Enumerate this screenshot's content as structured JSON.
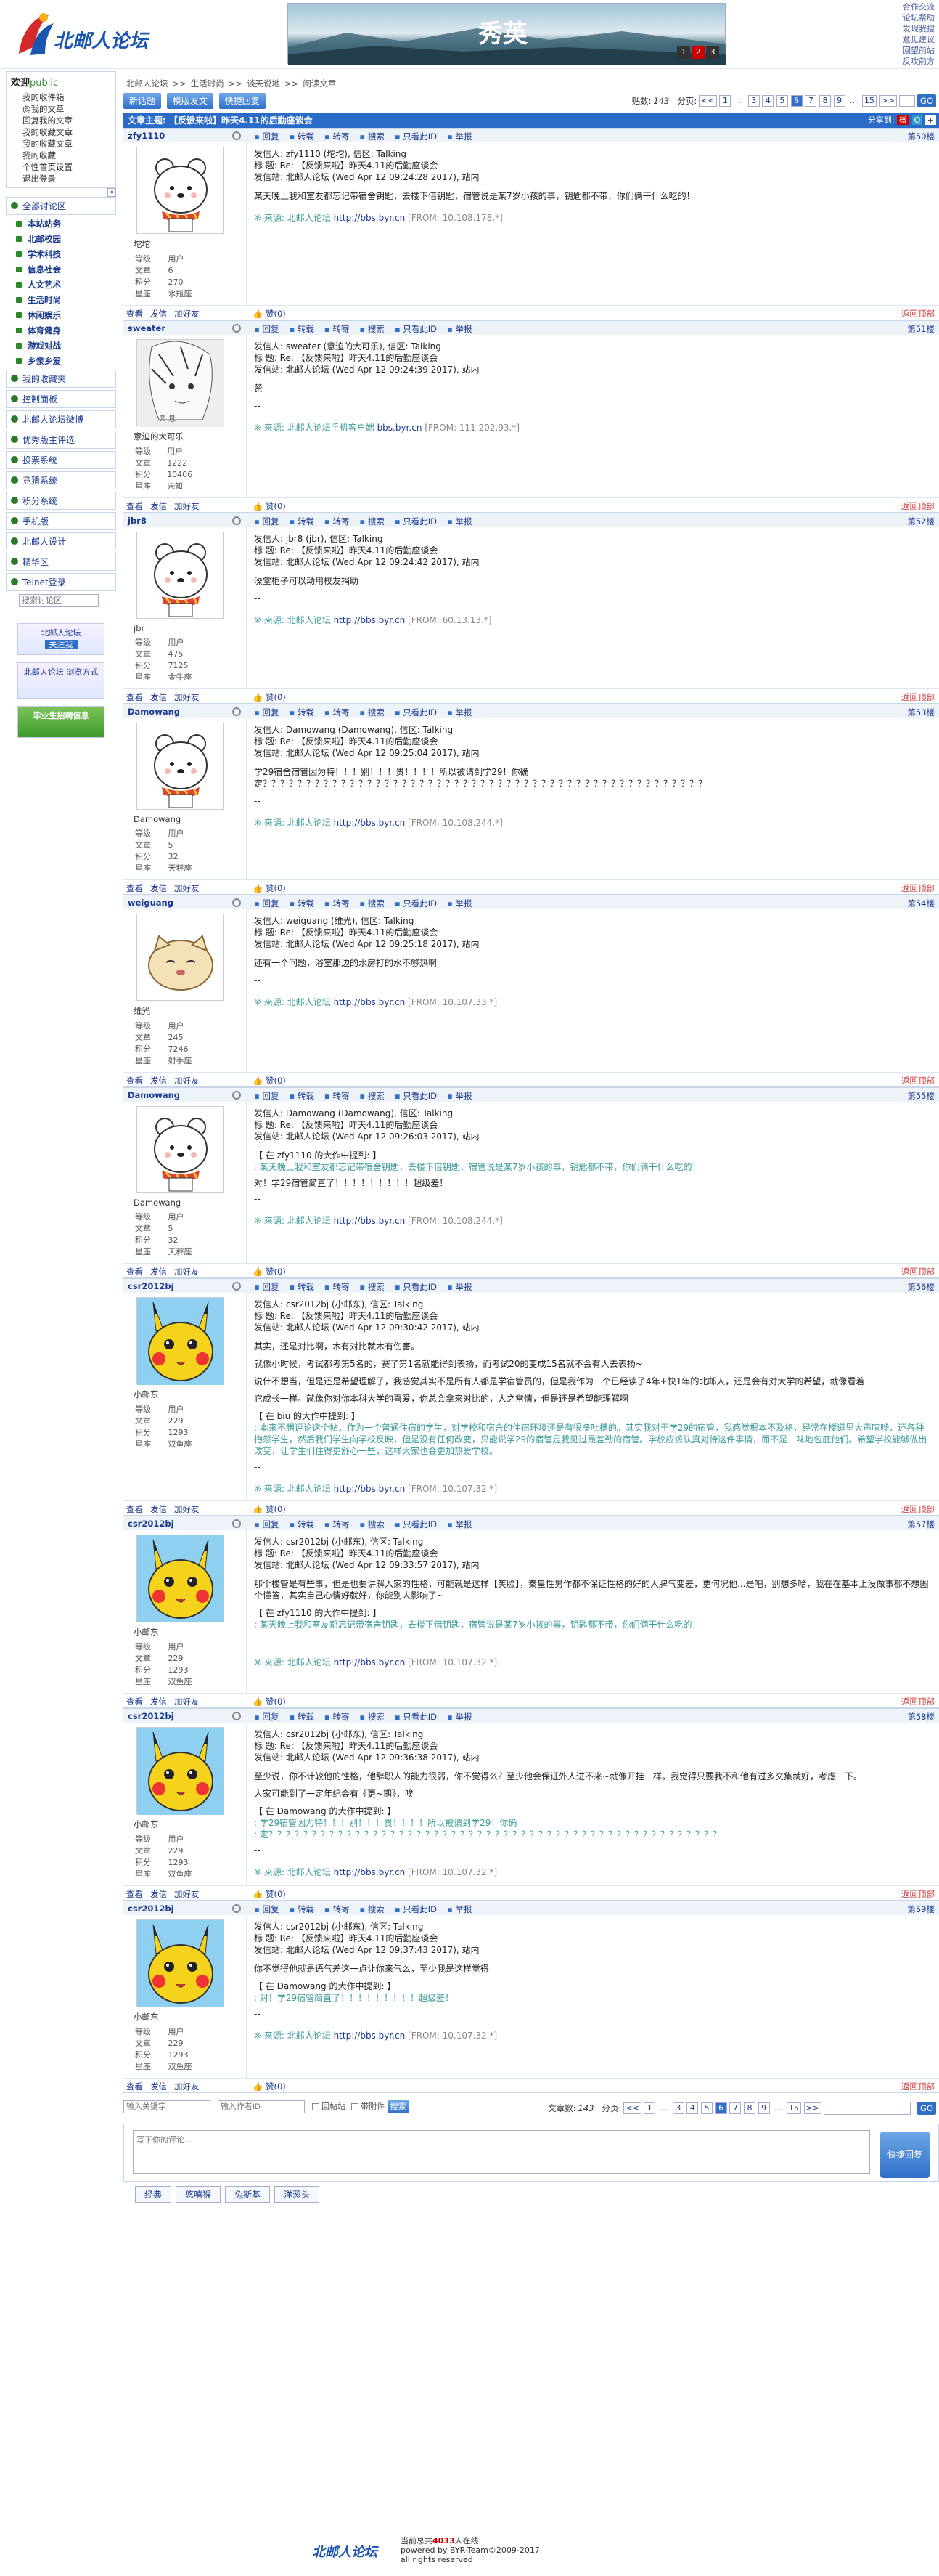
{
  "logo_text": "北邮人论坛",
  "banner": {
    "title": "秀英",
    "dots": [
      "1",
      "2",
      "3"
    ]
  },
  "toplinks": [
    "合作交流",
    "论坛帮助",
    "发现我搜",
    "意见建议",
    "回望前站",
    "反攻前方"
  ],
  "left": {
    "welcome": {
      "title": "欢迎",
      "user": "public",
      "items": [
        "我的收件箱",
        "@我的文章",
        "回复我的文章",
        "我的收藏文章",
        "我的收藏文章",
        "我的收藏",
        "个性首页设置",
        "退出登录"
      ]
    },
    "nav": [
      "全部讨论区",
      "本站站务",
      "北邮校园",
      "学术科技",
      "信息社会",
      "人文艺术",
      "生活时尚",
      "休闲娱乐",
      "体育健身",
      "游戏对战",
      "乡亲乡爱",
      "我的收藏夹",
      "控制面板",
      "北邮人论坛微博",
      "优秀版主评选",
      "投票系统",
      "竞猜系统",
      "积分系统",
      "手机版",
      "北邮人设计",
      "精华区",
      "Telnet登录"
    ],
    "search_ph": "搜索讨论区",
    "promo1": "北邮人论坛",
    "promo1b": "关注我",
    "promo2": "北邮人论坛 浏览方式",
    "promo3": "毕业生招聘信息"
  },
  "crumbs": [
    "北邮人论坛",
    ">>",
    "生活时尚",
    ">>",
    "谈天说地",
    ">>",
    "阅读文章"
  ],
  "toolbar": {
    "new": "新话题",
    "mod": "模版发文",
    "quick": "快捷回复",
    "count_label": "贴数:",
    "count": "143",
    "page_label": "分页:",
    "pages": [
      "<<",
      "1",
      "...",
      "3",
      "4",
      "5",
      "6",
      "7",
      "8",
      "9",
      "...",
      "15",
      ">>"
    ],
    "go": "GO"
  },
  "subject": {
    "label": "文章主题: 【反馈来啦】昨天4.11的后勤座谈会",
    "share": "分享到:"
  },
  "actions": [
    "回复",
    "转载",
    "转寄",
    "搜索",
    "只看此ID",
    "举报"
  ],
  "footer_actions": [
    "查看",
    "发信",
    "加好友"
  ],
  "praise": "赞(0)",
  "back_top": "返回顶部",
  "stat_labels": [
    "等级",
    "文章",
    "积分",
    "星座"
  ],
  "posts": [
    {
      "uid": "zfy1110",
      "floor": "第50楼",
      "name": "坨坨",
      "stats": [
        "用户",
        "6",
        "270",
        "水瓶座"
      ],
      "meta": [
        "发信人: zfy1110 (坨坨), 信区: Talking",
        "标  题: Re: 【反馈来啦】昨天4.11的后勤座谈会",
        "发信站: 北邮人论坛 (Wed Apr 12 09:24:28 2017), 站内"
      ],
      "text": [
        "某天晚上我和室友都忘记带宿舍钥匙，去楼下借钥匙，宿管说是某7岁小孩的事，钥匙都不带，你们俩干什么吃的！"
      ],
      "quote": [],
      "after": [],
      "src": "※ 来源: 北邮人论坛",
      "srcurl": "http://bbs.byr.cn",
      "ip": "[FROM: 10.108.178.*]"
    },
    {
      "uid": "sweater",
      "floor": "第51楼",
      "name": "意迫的大可乐",
      "stats": [
        "用户",
        "1222",
        "10406",
        "未知"
      ],
      "meta": [
        "发信人: sweater (意迫的大可乐), 信区: Talking",
        "标  题: Re: 【反馈来啦】昨天4.11的后勤座谈会",
        "发信站: 北邮人论坛 (Wed Apr 12 09:24:39 2017), 站内"
      ],
      "text": [
        "赞",
        "--"
      ],
      "quote": [],
      "after": [],
      "src": "※ 来源: 北邮人论坛手机客户端",
      "srcurl": "bbs.byr.cn",
      "ip": "[FROM: 111.202.93.*]"
    },
    {
      "uid": "jbr8",
      "floor": "第52楼",
      "name": "jbr",
      "stats": [
        "用户",
        "475",
        "7125",
        "金牛座"
      ],
      "meta": [
        "发信人: jbr8 (jbr), 信区: Talking",
        "标  题: Re: 【反馈来啦】昨天4.11的后勤座谈会",
        "发信站: 北邮人论坛 (Wed Apr 12 09:24:42 2017), 站内"
      ],
      "text": [
        "澡堂柜子可以动用校友捐助",
        "--"
      ],
      "quote": [],
      "after": [],
      "src": "※ 来源: 北邮人论坛",
      "srcurl": "http://bbs.byr.cn",
      "ip": "[FROM: 60.13.13.*]"
    },
    {
      "uid": "Damowang",
      "floor": "第53楼",
      "name": "Damowang",
      "stats": [
        "用户",
        "5",
        "32",
        "天秤座"
      ],
      "meta": [
        "发信人: Damowang (Damowang), 信区: Talking",
        "标  题: Re: 【反馈来啦】昨天4.11的后勤座谈会",
        "发信站: 北邮人论坛 (Wed Apr 12 09:25:04 2017), 站内"
      ],
      "text": [
        "学29宿舍宿管因为特！！！别！！！贵！！！！所以被请到学29！你确定？？？？？？？？？？？？？？？？？？？？？？？？？？？？？？？？？？？？？？？？？？？？？？？？？？？",
        "--"
      ],
      "quote": [],
      "after": [],
      "src": "※ 来源: 北邮人论坛",
      "srcurl": "http://bbs.byr.cn",
      "ip": "[FROM: 10.108.244.*]"
    },
    {
      "uid": "weiguang",
      "floor": "第54楼",
      "name": "维光",
      "stats": [
        "用户",
        "245",
        "7246",
        "射手座"
      ],
      "meta": [
        "发信人: weiguang (维光), 信区: Talking",
        "标  题: Re: 【反馈来啦】昨天4.11的后勤座谈会",
        "发信站: 北邮人论坛 (Wed Apr 12 09:25:18 2017), 站内"
      ],
      "text": [
        "还有一个问题，浴室那边的水房打的水不够热啊",
        "--"
      ],
      "quote": [],
      "after": [],
      "src": "※ 来源: 北邮人论坛",
      "srcurl": "http://bbs.byr.cn",
      "ip": "[FROM: 10.107.33.*]"
    },
    {
      "uid": "Damowang",
      "floor": "第55楼",
      "name": "Damowang",
      "stats": [
        "用户",
        "5",
        "32",
        "天秤座"
      ],
      "meta": [
        "发信人: Damowang (Damowang), 信区: Talking",
        "标  题: Re: 【反馈来啦】昨天4.11的后勤座谈会",
        "发信站: 北邮人论坛 (Wed Apr 12 09:26:03 2017), 站内"
      ],
      "text": [
        "【 在 zfy1110 的大作中提到: 】"
      ],
      "quote": [
        ": 某天晚上我和室友都忘记带宿舍钥匙，去楼下借钥匙，宿管说是某7岁小孩的事，钥匙都不带，你们俩干什么吃的！"
      ],
      "after": [
        "对！学29宿管简直了！！！！！！！！！超级差！",
        "--"
      ],
      "src": "※ 来源: 北邮人论坛",
      "srcurl": "http://bbs.byr.cn",
      "ip": "[FROM: 10.108.244.*]"
    },
    {
      "uid": "csr2012bj",
      "floor": "第56楼",
      "name": "小邮东",
      "stats": [
        "用户",
        "229",
        "1293",
        "双鱼座"
      ],
      "meta": [
        "发信人: csr2012bj (小邮东), 信区: Talking",
        "标  题: Re: 【反馈来啦】昨天4.11的后勤座谈会",
        "发信站: 北邮人论坛 (Wed Apr 12 09:30:42 2017), 站内"
      ],
      "text": [
        "其实，还是对比啊，木有对比就木有伤害。",
        "就像小时候，考试都考第5名的，赛了第1名就能得到表扬，而考试20的变成15名就不会有人去表扬~",
        "说什不想当，但是还是希望理解了，我感觉其实不是所有人都是学宿管员的，但是我作为一个已经读了4年+快1年的北邮人，还是会有对大学的希望，就像看着",
        "它成长一样。就像你对你本科大学的喜爱，你总会拿来对比的，人之常情，但是还是希望能理解啊",
        "【 在 biu 的大作中提到: 】"
      ],
      "quote": [
        ": 本来不想评论这个帖，作为一个普通住宿的学生，对学校和宿舍的住宿环境还是有很多吐槽的。其实我对于学29的宿管，我感觉根本不及格，经常在楼道里大声喧哗，还各种抱怨学生，然后我们学生向学校反映，但是没有任何改变，只能说学29的宿管是我见过最差劲的宿管。学校应该认真对待这件事情，而不是一味地包庇他们。希望学校能够做出改变，让学生们住得更舒心一些，这样大家也会更加热爱学校。"
      ],
      "after": [
        "--"
      ],
      "src": "※ 来源: 北邮人论坛",
      "srcurl": "http://bbs.byr.cn",
      "ip": "[FROM: 10.107.32.*]"
    },
    {
      "uid": "csr2012bj",
      "floor": "第57楼",
      "name": "小邮东",
      "stats": [
        "用户",
        "229",
        "1293",
        "双鱼座"
      ],
      "meta": [
        "发信人: csr2012bj (小邮东), 信区: Talking",
        "标  题: Re: 【反馈来啦】昨天4.11的后勤座谈会",
        "发信站: 北邮人论坛 (Wed Apr 12 09:33:57 2017), 站内"
      ],
      "text": [
        "那个楼管是有些事，但是也要讲解入家的性格，可能就是这样【笑脸】，秦皇性男作都不保证性格的好的人脾气变差，更何况他...是吧，别想多哈，我在在基本上没做事都不想图个懂答，其实自己心情好就好，你能别人影响了~",
        "【 在 zfy1110 的大作中提到: 】"
      ],
      "quote": [
        ": 某天晚上我和室友都忘记带宿舍钥匙，去楼下借钥匙，宿管说是某7岁小孩的事，钥匙都不带，你们俩干什么吃的！"
      ],
      "after": [
        "--"
      ],
      "src": "※ 来源: 北邮人论坛",
      "srcurl": "http://bbs.byr.cn",
      "ip": "[FROM: 10.107.32.*]"
    },
    {
      "uid": "csr2012bj",
      "floor": "第58楼",
      "name": "小邮东",
      "stats": [
        "用户",
        "229",
        "1293",
        "双鱼座"
      ],
      "meta": [
        "发信人: csr2012bj (小邮东), 信区: Talking",
        "标  题: Re: 【反馈来啦】昨天4.11的后勤座谈会",
        "发信站: 北邮人论坛 (Wed Apr 12 09:36:38 2017), 站内"
      ],
      "text": [
        "至少说，你不计较他的性格，他辞职人的能力很弱，你不觉得么？至少他会保证外人进不来~就像开挂一样。我觉得只要我不和他有过多交集就好，考虑一下。",
        "人家可能到了一定年纪会有《更~期》，唉",
        "【 在 Damowang 的大作中提到: 】"
      ],
      "quote": [
        ": 学29宿管因为特！！！别！！！贵！！！！所以被请到学29！你确",
        ": 定？？？？？？？？？？？？？？？？？？？？？？？？？？？？？？？？？？？？？？？？？？？？？？？？？？？？"
      ],
      "after": [
        "--"
      ],
      "src": "※ 来源: 北邮人论坛",
      "srcurl": "http://bbs.byr.cn",
      "ip": "[FROM: 10.107.32.*]"
    },
    {
      "uid": "csr2012bj",
      "floor": "第59楼",
      "name": "小邮东",
      "stats": [
        "用户",
        "229",
        "1293",
        "双鱼座"
      ],
      "meta": [
        "发信人: csr2012bj (小邮东), 信区: Talking",
        "标  题: Re: 【反馈来啦】昨天4.11的后勤座谈会",
        "发信站: 北邮人论坛 (Wed Apr 12 09:37:43 2017), 站内"
      ],
      "text": [
        "你不觉得他就是语气差这一点让你来气么，至少我是这样觉得",
        "【 在 Damowang 的大作中提到: 】"
      ],
      "quote": [
        ": 对！学29宿管简直了！！！！！！！！！超级差！"
      ],
      "after": [
        "--"
      ],
      "src": "※ 来源: 北邮人论坛",
      "srcurl": "http://bbs.byr.cn",
      "ip": "[FROM: 10.107.32.*]"
    }
  ],
  "bottom": {
    "search_ph1": "输入关键字",
    "search_ph2": "输入作者ID",
    "opt1": "回帖站",
    "opt2": "带附件",
    "search_btn": "搜索",
    "count_label": "文章数:",
    "count": "143"
  },
  "reply": {
    "placeholder": "写下你的评论...",
    "button": "快捷回复",
    "tabs": [
      "经典",
      "悠嘻猴",
      "兔斯基",
      "洋葱头"
    ]
  },
  "footer": {
    "logo": "北邮人论坛",
    "line1a": "当前总共",
    "online": "4033",
    "line1b": "人在线",
    "line2": "powered by BYR-Team©2009-2017.",
    "line3": "all rights reserved"
  }
}
